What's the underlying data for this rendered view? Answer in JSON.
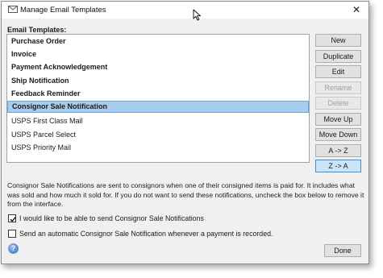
{
  "window": {
    "title": "Manage Email Templates",
    "close_glyph": "✕"
  },
  "list": {
    "label": "Email Templates:",
    "items": [
      {
        "label": "Purchase Order",
        "bold": true,
        "selected": false
      },
      {
        "label": "Invoice",
        "bold": true,
        "selected": false
      },
      {
        "label": "Payment Acknowledgement",
        "bold": true,
        "selected": false
      },
      {
        "label": "Ship Notification",
        "bold": true,
        "selected": false
      },
      {
        "label": "Feedback Reminder",
        "bold": true,
        "selected": false
      },
      {
        "label": "Consignor Sale Notification",
        "bold": true,
        "selected": true
      },
      {
        "label": "USPS First Class Mail",
        "bold": false,
        "selected": false
      },
      {
        "label": "USPS Parcel Select",
        "bold": false,
        "selected": false
      },
      {
        "label": "USPS Priority  Mail",
        "bold": false,
        "selected": false
      }
    ]
  },
  "buttons": {
    "new": "New",
    "duplicate": "Duplicate",
    "edit": "Edit",
    "rename": "Rename",
    "delete": "Delete",
    "move_up": "Move Up",
    "move_down": "Move Down",
    "sort_asc": "A -> Z",
    "sort_desc": "Z -> A",
    "done": "Done"
  },
  "button_states": {
    "rename_disabled": true,
    "delete_disabled": true,
    "sort_desc_pressed": true
  },
  "info": {
    "text": "Consignor Sale Notifications are sent to consignors when one of their consigned items is paid for.  It includes what was sold and how much it sold for.  If you do not want to send these notifications, uncheck the box below to remove it from the interface."
  },
  "options": {
    "enable_consignor_label": "I would like to be able to send Consignor Sale Notifications",
    "enable_consignor_checked": true,
    "auto_send_label": "Send an automatic Consignor Sale Notification whenever a payment is recorded.",
    "auto_send_checked": false
  },
  "colors": {
    "selection": "#a6cdee",
    "pressed_button": "#cce4f7",
    "help_icon": "#3d74c2"
  },
  "icons": {
    "title": "envelope-icon",
    "close": "close-icon",
    "help": "help-icon",
    "cursor": "mouse-cursor-icon",
    "help_glyph": "?"
  }
}
